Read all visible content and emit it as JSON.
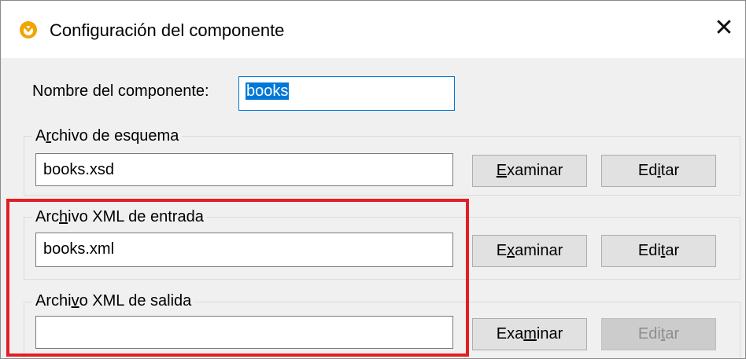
{
  "dialog": {
    "title": "Configuración del componente",
    "close_glyph": "✕"
  },
  "component_name": {
    "label_before": "Nombre del componente:",
    "value": "books"
  },
  "schema_file": {
    "legend_a": "A",
    "legend_accel": "r",
    "legend_b": "chivo de esquema",
    "value": "books.xsd",
    "browse": {
      "accel": "E",
      "rest": "xaminar"
    },
    "edit": {
      "a": "Ed",
      "accel": "i",
      "b": "tar"
    }
  },
  "input_xml": {
    "legend_a": "Arc",
    "legend_accel": "h",
    "legend_b": "ivo XML de entrada",
    "value": "books.xml",
    "browse": {
      "a": "E",
      "accel": "x",
      "b": "aminar"
    },
    "edit": {
      "a": "Edi",
      "accel": "t",
      "b": "ar"
    }
  },
  "output_xml": {
    "legend_a": "Archi",
    "legend_accel": "v",
    "legend_b": "o XML de salida",
    "value": "",
    "browse": {
      "a": "Exa",
      "accel": "m",
      "b": "inar"
    },
    "edit": {
      "a": "Edi",
      "accel": "t",
      "b": "ar",
      "disabled": true
    }
  },
  "colors": {
    "highlight": "#e31e24",
    "selection": "#0078d7",
    "dialog_bg": "#f0f0f0"
  }
}
